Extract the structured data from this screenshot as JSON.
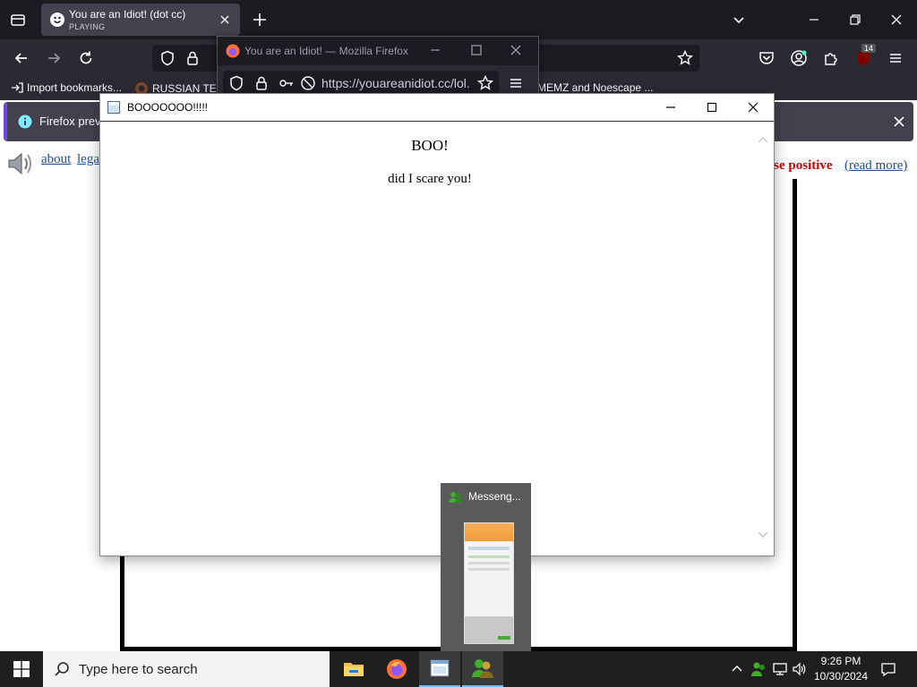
{
  "browser": {
    "tab": {
      "title": "You are an Idiot! (dot cc)",
      "status": "PLAYING"
    },
    "bookmarks": [
      {
        "label": "Import bookmarks..."
      },
      {
        "label": "RUSSIAN TEST"
      },
      {
        "label": "MEMZ and Noescape ..."
      }
    ],
    "notice": {
      "text": "Firefox preven"
    }
  },
  "page": {
    "links": {
      "about": "about",
      "legal": "lega"
    },
    "false_positive": "lse positive",
    "read_more": "(read more)"
  },
  "popup_browser": {
    "title": "You are an Idiot! — Mozilla Firefox",
    "url": "https://youareanidiot.cc/lol."
  },
  "dialog": {
    "title": "BOOOOOOO!!!!!",
    "heading": "BOO!",
    "message": "did I scare you!"
  },
  "thumbnail": {
    "title": "Messeng..."
  },
  "taskbar": {
    "search_placeholder": "Type here to search",
    "time": "9:26 PM",
    "date": "10/30/2024",
    "extension_badge": "14"
  }
}
